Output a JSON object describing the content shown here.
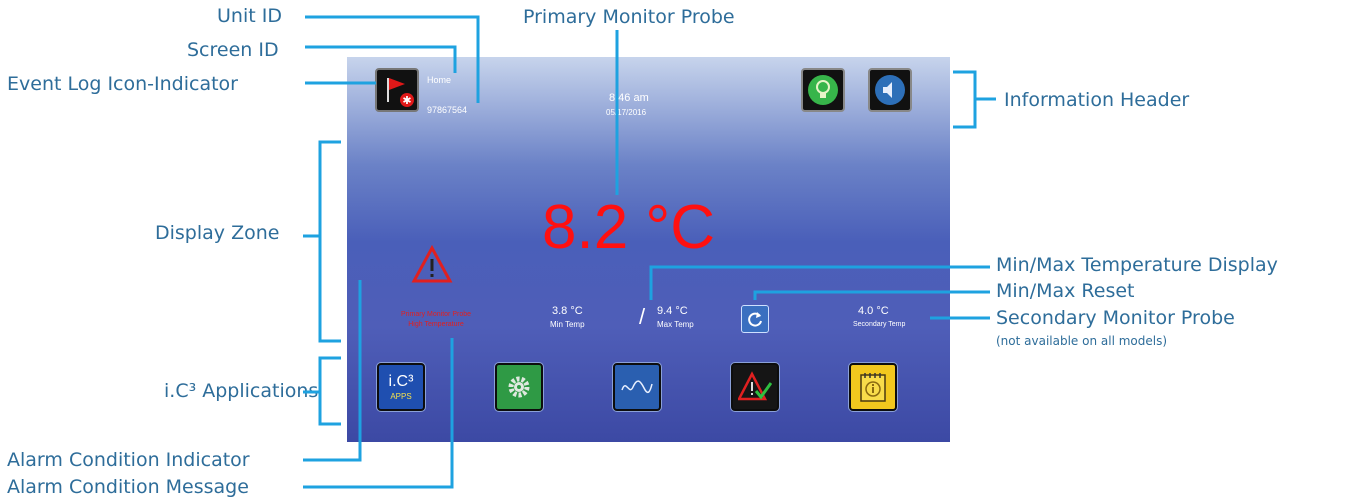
{
  "callouts": {
    "unit_id": "Unit ID",
    "screen_id": "Screen ID",
    "event_log": "Event Log Icon-Indicator",
    "primary_probe": "Primary Monitor Probe",
    "info_header": "Information Header",
    "display_zone": "Display Zone",
    "minmax_display": "Min/Max Temperature Display",
    "minmax_reset": "Min/Max Reset",
    "secondary_probe": "Secondary Monitor Probe",
    "secondary_note": "(not available on all models)",
    "apps": "i.C³ Applications",
    "alarm_indicator": "Alarm Condition Indicator",
    "alarm_message": "Alarm Condition Message"
  },
  "screen": {
    "screen_name": "Home",
    "unit_id": "97867564",
    "time": "8:46 am",
    "date": "05/17/2016",
    "temperature": "8.2 °C",
    "min_temp": "3.8 °C",
    "min_label": "Min Temp",
    "max_temp": "9.4 °C",
    "max_label": "Max Temp",
    "slash": "/",
    "secondary_temp": "4.0 °C",
    "secondary_label": "Secondary Temp",
    "alarm_line1": "Primary Monitor Probe",
    "alarm_line2": "High Temperature",
    "apps_label_top": "i.C³",
    "apps_label_bottom": "APPS"
  },
  "colors": {
    "callout": "#2e6d9a",
    "leader": "#1ea2e0",
    "temperature": "#ff1010",
    "alarm": "#e02020"
  },
  "icons": {
    "event_log": "red-flag-icon",
    "light": "lightbulb-icon",
    "sound": "speaker-icon",
    "reset": "reset-arrow-icon",
    "alarm": "warning-triangle-icon",
    "settings": "gear-icon",
    "graph": "wave-graph-icon",
    "alarm_test": "alarm-check-icon",
    "info": "info-notepad-icon"
  }
}
